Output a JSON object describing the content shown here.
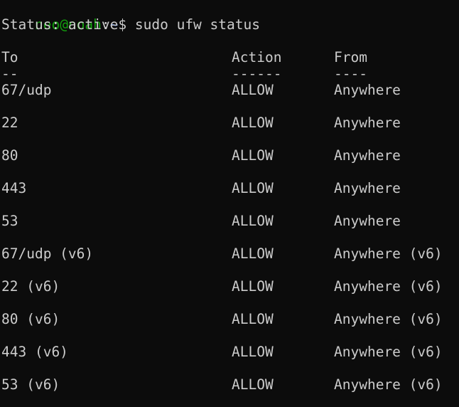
{
  "prompt": {
    "user_host": "neo@noah",
    "separator": ":",
    "path": "~",
    "symbol": "$",
    "command": " sudo ufw status"
  },
  "status_line": "Status: active",
  "table": {
    "headers": {
      "to": "To",
      "action": "Action",
      "from": "From"
    },
    "dividers": {
      "to": "--",
      "action": "------",
      "from": "----"
    },
    "rows": [
      {
        "to": "67/udp",
        "action": "ALLOW",
        "from": "Anywhere"
      },
      {
        "to": "22",
        "action": "ALLOW",
        "from": "Anywhere"
      },
      {
        "to": "80",
        "action": "ALLOW",
        "from": "Anywhere"
      },
      {
        "to": "443",
        "action": "ALLOW",
        "from": "Anywhere"
      },
      {
        "to": "53",
        "action": "ALLOW",
        "from": "Anywhere"
      },
      {
        "to": "67/udp (v6)",
        "action": "ALLOW",
        "from": "Anywhere (v6)"
      },
      {
        "to": "22 (v6)",
        "action": "ALLOW",
        "from": "Anywhere (v6)"
      },
      {
        "to": "80 (v6)",
        "action": "ALLOW",
        "from": "Anywhere (v6)"
      },
      {
        "to": "443 (v6)",
        "action": "ALLOW",
        "from": "Anywhere (v6)"
      },
      {
        "to": "53 (v6)",
        "action": "ALLOW",
        "from": "Anywhere (v6)"
      }
    ]
  },
  "colors": {
    "background": "#0c0c0c",
    "text": "#cccccc",
    "prompt_user": "#13a10e",
    "prompt_path": "#3b78ff"
  }
}
